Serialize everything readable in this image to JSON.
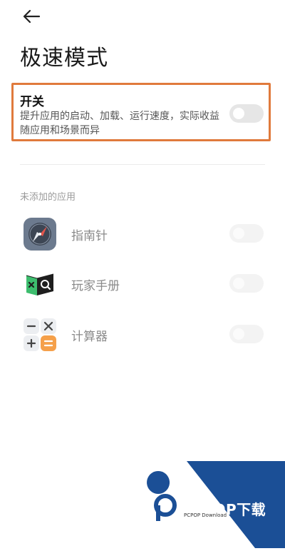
{
  "header": {
    "back_icon": "arrow-left-icon",
    "title": "极速模式"
  },
  "speed_switch": {
    "title": "开关",
    "description": "提升应用的启动、加载、运行速度，实际收益随应用和场景而异",
    "enabled": false,
    "highlight_color": "#e07a3c"
  },
  "section": {
    "label": "未添加的应用"
  },
  "apps": [
    {
      "name": "指南针",
      "icon": "compass-app-icon",
      "enabled": false
    },
    {
      "name": "玩家手册",
      "icon": "game-handbook-app-icon",
      "enabled": false
    },
    {
      "name": "计算器",
      "icon": "calculator-app-icon",
      "enabled": false
    }
  ],
  "watermark": {
    "brand": "PCPOP下载",
    "sub": "PCPOP Download",
    "color": "#1b4f96"
  }
}
